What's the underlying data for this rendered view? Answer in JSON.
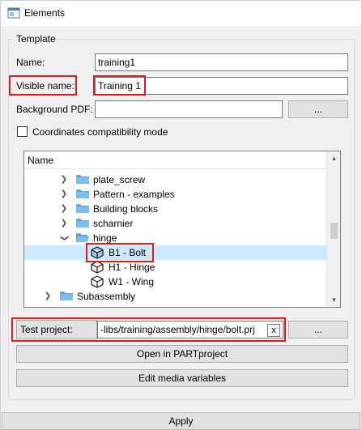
{
  "window": {
    "title": "Elements"
  },
  "template": {
    "group_title": "Template",
    "name": {
      "label": "Name:",
      "value": "training1"
    },
    "visible_name": {
      "label": "Visible name:",
      "value": "Training 1"
    },
    "background_pdf": {
      "label": "Background PDF:",
      "value": "",
      "browse_label": "..."
    },
    "coordinates_compat": {
      "label": "Coordinates compatibility mode",
      "checked": false
    },
    "tree": {
      "header": "Name",
      "items": [
        {
          "label": "plate_screw",
          "icon": "folder-icon",
          "expanded": false
        },
        {
          "label": "Pattern - examples",
          "icon": "folder-icon",
          "expanded": false
        },
        {
          "label": "Building blocks",
          "icon": "folder-icon",
          "expanded": false
        },
        {
          "label": "scharnier",
          "icon": "folder-icon",
          "expanded": false
        },
        {
          "label": "hinge",
          "icon": "folder-icon",
          "expanded": true
        },
        {
          "label": "B1 - Bolt",
          "icon": "cube-icon",
          "selected": true
        },
        {
          "label": "H1 - Hinge",
          "icon": "cube-icon"
        },
        {
          "label": "W1 - Wing",
          "icon": "cube-icon"
        },
        {
          "label": "Subassembly",
          "icon": "folder-icon",
          "expanded": false
        }
      ]
    },
    "test_project": {
      "label": "Test project:",
      "value": "-libs/training/assembly/hinge/bolt.prj",
      "clear_label": "x",
      "browse_label": "..."
    },
    "open_button": "Open in PARTproject",
    "edit_media_button": "Edit media variables"
  },
  "apply_button": "Apply",
  "colors": {
    "highlight": "#e01b1b",
    "selection": "#cde8ff",
    "folder": "#5aa7d8"
  }
}
